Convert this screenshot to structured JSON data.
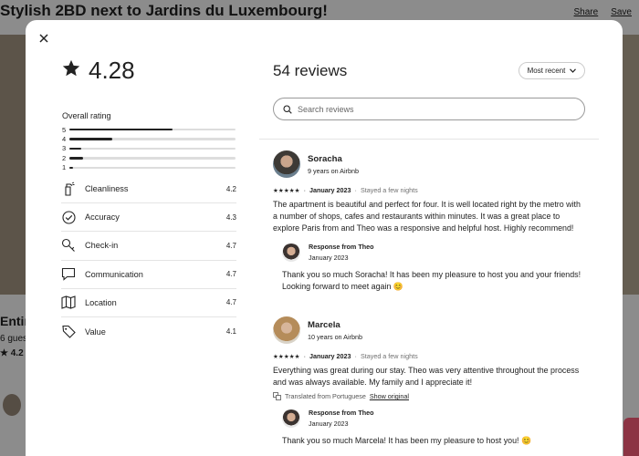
{
  "background": {
    "title": "Stylish 2BD next to Jardins du Luxembourg!",
    "share": "Share",
    "save": "Save",
    "entire": "Entir",
    "guests": "6 gues",
    "rating": "4.2"
  },
  "modal": {
    "close_icon": "close-icon",
    "overall_score": "4.28",
    "overall_label": "Overall rating",
    "distribution": [
      {
        "stars": "5",
        "fraction": 0.62
      },
      {
        "stars": "4",
        "fraction": 0.26
      },
      {
        "stars": "3",
        "fraction": 0.07
      },
      {
        "stars": "2",
        "fraction": 0.08
      },
      {
        "stars": "1",
        "fraction": 0.02
      }
    ],
    "categories": [
      {
        "label": "Cleanliness",
        "value": "4.2",
        "icon": "spray-bottle-icon"
      },
      {
        "label": "Accuracy",
        "value": "4.3",
        "icon": "check-circle-icon"
      },
      {
        "label": "Check-in",
        "value": "4.7",
        "icon": "key-icon"
      },
      {
        "label": "Communication",
        "value": "4.7",
        "icon": "chat-bubble-icon"
      },
      {
        "label": "Location",
        "value": "4.7",
        "icon": "map-icon"
      },
      {
        "label": "Value",
        "value": "4.1",
        "icon": "tag-icon"
      }
    ],
    "reviews_title": "54 reviews",
    "sort_label": "Most recent",
    "search_placeholder": "Search reviews",
    "reviews": [
      {
        "name": "Soracha",
        "tenure": "9 years on Airbnb",
        "stars": "★★★★★",
        "date": "January 2023",
        "stay": "Stayed a few nights",
        "text": "The apartment is beautiful and perfect for four. It is well located right by the metro with a number of shops, cafes and restaurants within minutes. It was a great place to explore Paris from and Theo was a responsive and helpful host. Highly recommend!",
        "response_title": "Response from Theo",
        "response_date": "January 2023",
        "response_text": "Thank you so much Soracha! It has been my pleasure to host you and your friends! Looking forward to meet again 😊"
      },
      {
        "name": "Marcela",
        "tenure": "10 years on Airbnb",
        "stars": "★★★★★",
        "date": "January 2023",
        "stay": "Stayed a few nights",
        "text": "Everything was great during our stay. Theo was very attentive throughout the process and was always available. My family and I appreciate it!",
        "translated": "Translated from Portuguese",
        "show_original": "Show original",
        "response_title": "Response from Theo",
        "response_date": "January 2023",
        "response_text": "Thank you so much Marcela! It has been my pleasure to host you! 😊"
      }
    ]
  }
}
